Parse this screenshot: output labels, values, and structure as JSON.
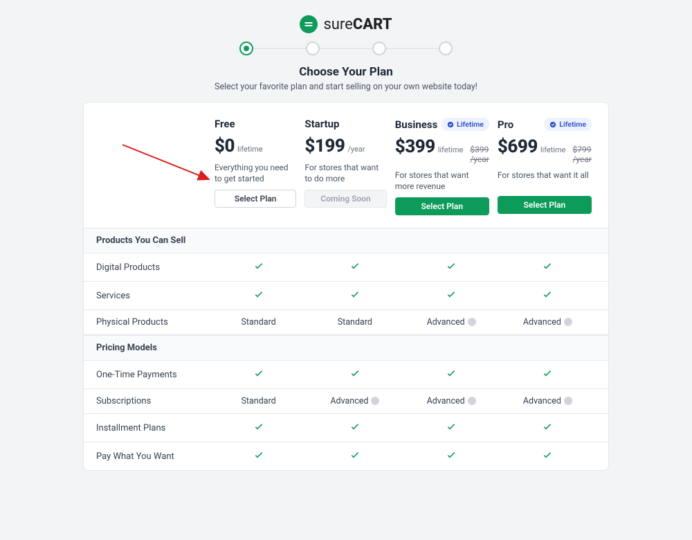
{
  "brand": {
    "pre": "sure",
    "bold": "CART"
  },
  "heading": "Choose Your Plan",
  "subheading": "Select your favorite plan and start selling on your own website today!",
  "lifetime_badge": "Lifetime",
  "plans": [
    {
      "name": "Free",
      "price": "$0",
      "per": "lifetime",
      "strike": "",
      "desc": "Everything you need to get started",
      "cta": "Select Plan",
      "cta_style": "outline",
      "badge": false
    },
    {
      "name": "Startup",
      "price": "$199",
      "per": "/year",
      "strike": "",
      "desc": "For stores that want to do more",
      "cta": "Coming Soon",
      "cta_style": "disabled",
      "badge": false
    },
    {
      "name": "Business",
      "price": "$399",
      "per": "lifetime",
      "strike": "$399 /year",
      "desc": "For stores that want more revenue",
      "cta": "Select Plan",
      "cta_style": "primary",
      "badge": true
    },
    {
      "name": "Pro",
      "price": "$699",
      "per": "lifetime",
      "strike": "$799 /year",
      "desc": "For stores that want it all",
      "cta": "Select Plan",
      "cta_style": "primary",
      "badge": true
    }
  ],
  "sections": [
    {
      "title": "Products You Can Sell",
      "rows": [
        {
          "name": "Digital Products",
          "cells": [
            "check",
            "check",
            "check",
            "check"
          ]
        },
        {
          "name": "Services",
          "cells": [
            "check",
            "check",
            "check",
            "check"
          ]
        },
        {
          "name": "Physical Products",
          "cells": [
            "Standard",
            "Standard",
            "Advanced_i",
            "Advanced_i"
          ]
        }
      ]
    },
    {
      "title": "Pricing Models",
      "rows": [
        {
          "name": "One-Time Payments",
          "cells": [
            "check",
            "check",
            "check",
            "check"
          ]
        },
        {
          "name": "Subscriptions",
          "cells": [
            "Standard",
            "Advanced_i",
            "Advanced_i",
            "Advanced_i"
          ]
        },
        {
          "name": "Installment Plans",
          "cells": [
            "check",
            "check",
            "check",
            "check"
          ]
        },
        {
          "name": "Pay What You Want",
          "cells": [
            "check",
            "check",
            "check",
            "check"
          ]
        }
      ]
    }
  ]
}
